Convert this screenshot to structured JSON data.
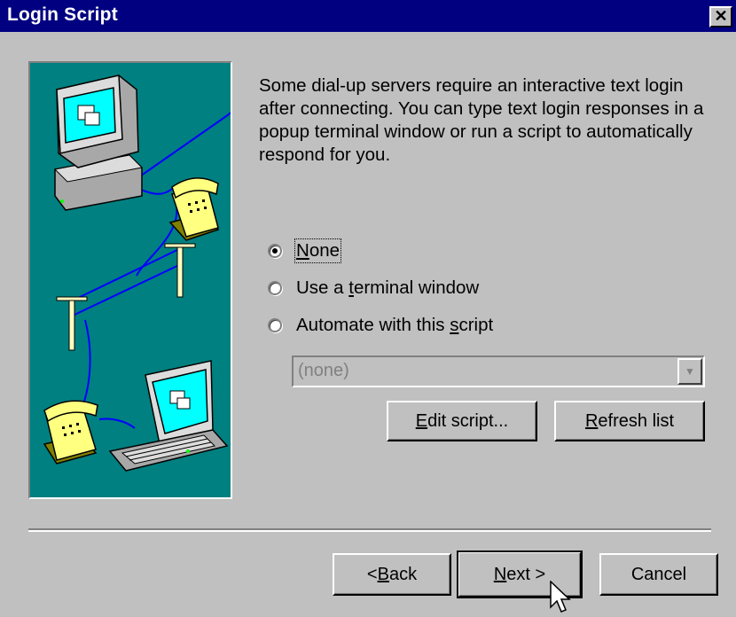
{
  "window": {
    "title": "Login Script",
    "close_glyph": "✕"
  },
  "description": "Some dial-up servers require an interactive text login after connecting.  You can type text login responses in a popup terminal window or run a script to automatically respond for you.",
  "options": [
    {
      "pre": "",
      "mn": "N",
      "post": "one",
      "checked": true
    },
    {
      "pre": "Use a ",
      "mn": "t",
      "post": "erminal window",
      "checked": false
    },
    {
      "pre": "Automate with this ",
      "mn": "s",
      "post": "cript",
      "checked": false
    }
  ],
  "script_select": {
    "value": "(none)",
    "enabled": false
  },
  "buttons": {
    "edit": {
      "mn": "E",
      "post": "dit script..."
    },
    "refresh": {
      "mn": "R",
      "post": "efresh list"
    },
    "back": {
      "pre": "< ",
      "mn": "B",
      "post": "ack"
    },
    "next": {
      "mn": "N",
      "post": "ext >"
    },
    "cancel": "Cancel"
  },
  "illustration": {
    "icons": [
      "desktop-computer-icon",
      "telephone-icon",
      "utility-pole-icon",
      "laptop-icon"
    ]
  },
  "colors": {
    "titlebar": "#000080",
    "face": "#c0c0c0",
    "illustration_bg": "#008080",
    "wire": "#0000ff"
  }
}
